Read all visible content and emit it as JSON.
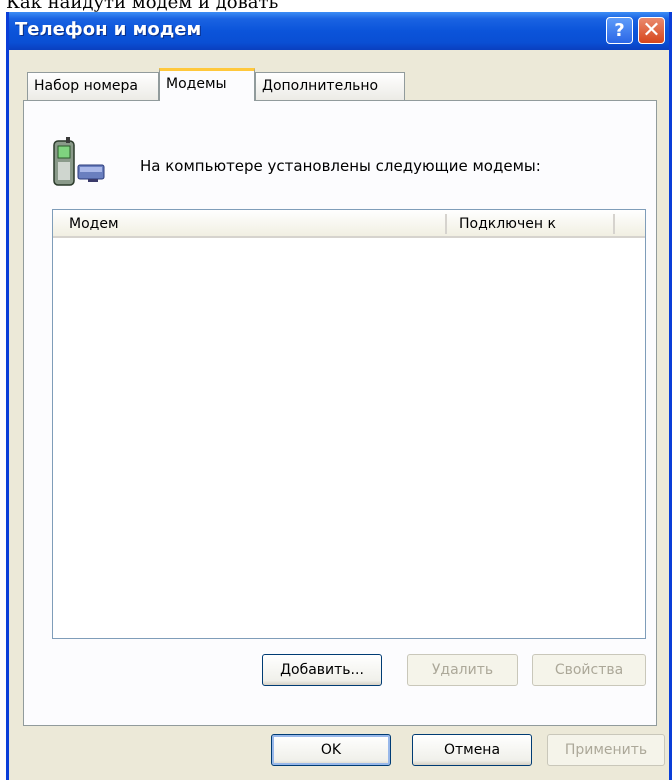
{
  "background_text": "Как найдути модем и довать",
  "window": {
    "title": "Телефон и модем",
    "help_glyph": "?",
    "close_glyph": "✕"
  },
  "tabs": [
    {
      "label": "Набор номера",
      "active": false
    },
    {
      "label": "Модемы",
      "active": true
    },
    {
      "label": "Дополнительно",
      "active": false
    }
  ],
  "modems_tab": {
    "intro": "На компьютере установлены следующие модемы:",
    "columns": [
      "Модем",
      "Подключен к"
    ],
    "rows": [],
    "buttons": {
      "add": "Добавить...",
      "remove": "Удалить",
      "properties": "Свойства"
    }
  },
  "footer": {
    "ok": "OK",
    "cancel": "Отмена",
    "apply": "Применить"
  },
  "colors": {
    "titlebar": "#0a54da",
    "window_border": "#0a3ed8",
    "dialog_face": "#ece9d8",
    "active_tab_accent": "#ffc83c"
  }
}
